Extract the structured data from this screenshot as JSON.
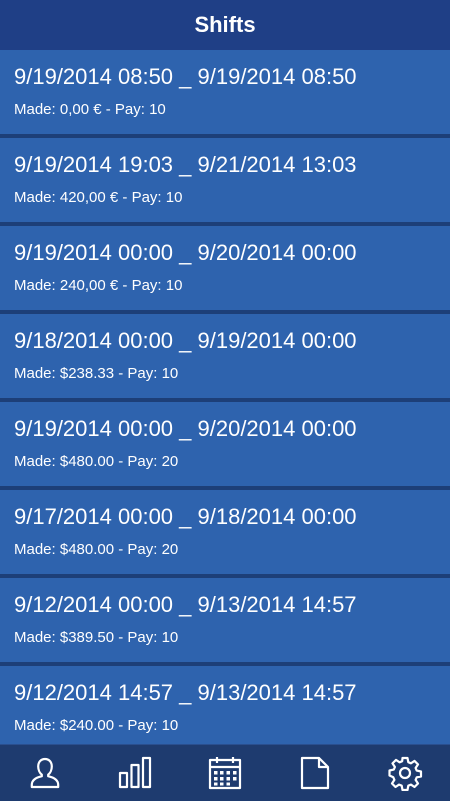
{
  "header": {
    "title": "Shifts"
  },
  "shifts": [
    {
      "range": "9/19/2014 08:50 _ 9/19/2014 08:50",
      "summary": "Made: 0,00 € - Pay: 10"
    },
    {
      "range": "9/19/2014 19:03 _ 9/21/2014 13:03",
      "summary": "Made: 420,00 € - Pay: 10"
    },
    {
      "range": "9/19/2014 00:00 _ 9/20/2014 00:00",
      "summary": "Made: 240,00 € - Pay: 10"
    },
    {
      "range": "9/18/2014 00:00 _ 9/19/2014 00:00",
      "summary": "Made: $238.33 - Pay: 10"
    },
    {
      "range": "9/19/2014 00:00 _ 9/20/2014 00:00",
      "summary": "Made: $480.00 - Pay: 20"
    },
    {
      "range": "9/17/2014 00:00 _ 9/18/2014 00:00",
      "summary": "Made: $480.00 - Pay: 20"
    },
    {
      "range": "9/12/2014 00:00 _ 9/13/2014 14:57",
      "summary": "Made: $389.50 - Pay: 10"
    },
    {
      "range": "9/12/2014 14:57 _ 9/13/2014 14:57",
      "summary": "Made: $240.00 - Pay: 10"
    }
  ],
  "tabbar": {
    "tabs": [
      {
        "icon": "profile-icon"
      },
      {
        "icon": "bar-chart-icon"
      },
      {
        "icon": "calendar-icon"
      },
      {
        "icon": "document-icon"
      },
      {
        "icon": "gear-icon"
      }
    ]
  },
  "colors": {
    "header_bg": "#1f3f86",
    "item_bg": "#2e63ae",
    "divider": "#1d3f78",
    "tabbar_bg": "#1e3b6f",
    "text": "#ffffff"
  }
}
